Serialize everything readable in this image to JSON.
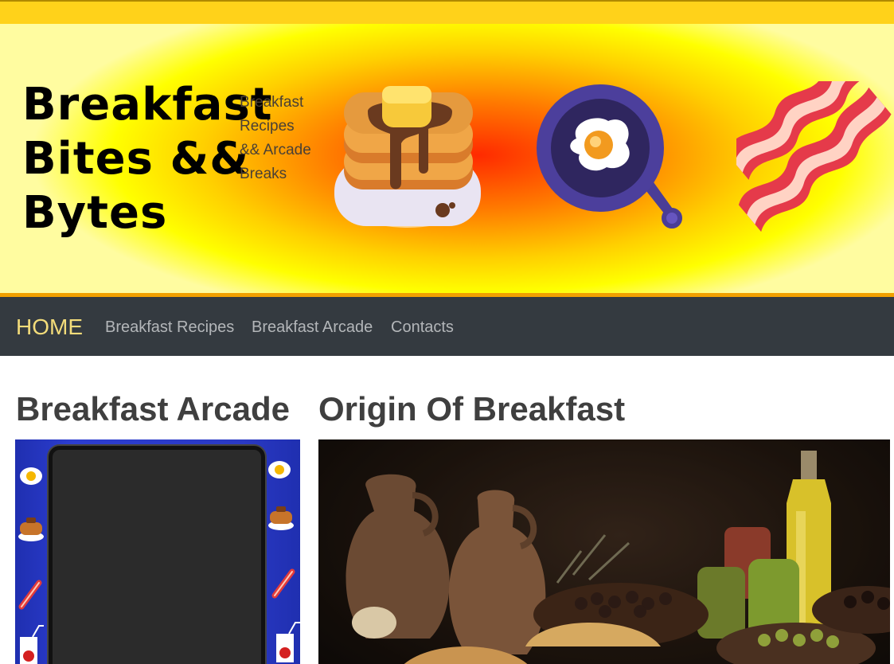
{
  "header": {
    "title": "Breakfast Bites && Bytes",
    "tagline": "Breakfast Recipes && Arcade Breaks",
    "icons": [
      "pancakes-icon",
      "frying-pan-egg-icon",
      "bacon-icon"
    ]
  },
  "nav": {
    "home": "HOME",
    "items": [
      {
        "label": "Breakfast Recipes"
      },
      {
        "label": "Breakfast Arcade"
      },
      {
        "label": "Contacts"
      }
    ]
  },
  "sections": {
    "left_heading": "Breakfast Arcade",
    "right_heading": "Origin Of Breakfast"
  },
  "colors": {
    "topbar": "#ffd21a",
    "nav_bg": "#343a40",
    "nav_border": "#f2a000",
    "nav_active": "#f3dc7a",
    "nav_link": "#b3b6b9",
    "heading": "#3f3f3f"
  }
}
